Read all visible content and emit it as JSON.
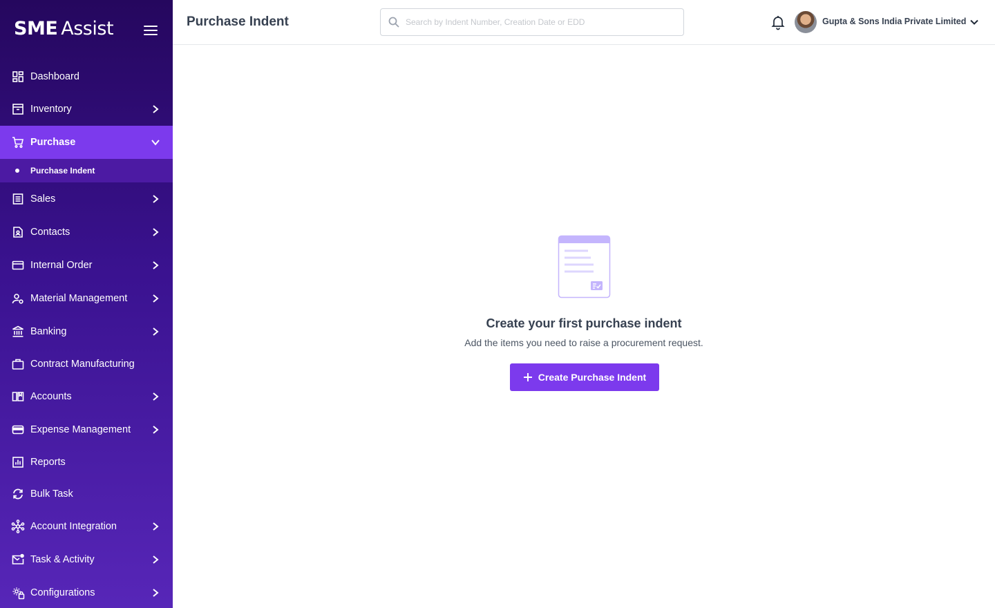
{
  "brand": {
    "part1": "SME",
    "part2": "Assist"
  },
  "sidebar": {
    "items": [
      {
        "label": "Dashboard",
        "icon": "dashboard-icon",
        "has_chevron": false
      },
      {
        "label": "Inventory",
        "icon": "inventory-icon",
        "has_chevron": true
      },
      {
        "label": "Purchase",
        "icon": "cart-icon",
        "has_chevron": true,
        "expanded": true,
        "active": true
      },
      {
        "label": "Sales",
        "icon": "sales-icon",
        "has_chevron": true
      },
      {
        "label": "Contacts",
        "icon": "contacts-icon",
        "has_chevron": true
      },
      {
        "label": "Internal Order",
        "icon": "card-icon",
        "has_chevron": true
      },
      {
        "label": "Material Management",
        "icon": "material-icon",
        "has_chevron": true
      },
      {
        "label": "Banking",
        "icon": "bank-icon",
        "has_chevron": true
      },
      {
        "label": "Contract Manufacturing",
        "icon": "briefcase-icon",
        "has_chevron": false
      },
      {
        "label": "Accounts",
        "icon": "book-icon",
        "has_chevron": true
      },
      {
        "label": "Expense Management",
        "icon": "wallet-icon",
        "has_chevron": true
      },
      {
        "label": "Reports",
        "icon": "reports-icon",
        "has_chevron": false
      },
      {
        "label": "Bulk Task",
        "icon": "sync-icon",
        "has_chevron": false
      },
      {
        "label": "Account Integration",
        "icon": "network-icon",
        "has_chevron": true
      },
      {
        "label": "Task & Activity",
        "icon": "mail-task-icon",
        "has_chevron": true
      },
      {
        "label": "Configurations",
        "icon": "config-icon",
        "has_chevron": true
      }
    ],
    "sub_items": [
      {
        "label": "Purchase Indent",
        "active": true
      }
    ]
  },
  "header": {
    "title": "Purchase Indent",
    "search_placeholder": "Search by Indent Number, Creation Date or EDD",
    "company_name": "Gupta & Sons India Private Limited"
  },
  "empty_state": {
    "title": "Create your first purchase indent",
    "description": "Add the items you need to raise a procurement request.",
    "button_label": "Create Purchase Indent"
  },
  "colors": {
    "accent": "#7c3aed",
    "sidebar_top": "#25075e",
    "sidebar_bottom": "#5726b8",
    "illustration_light": "#c4b5fd"
  }
}
